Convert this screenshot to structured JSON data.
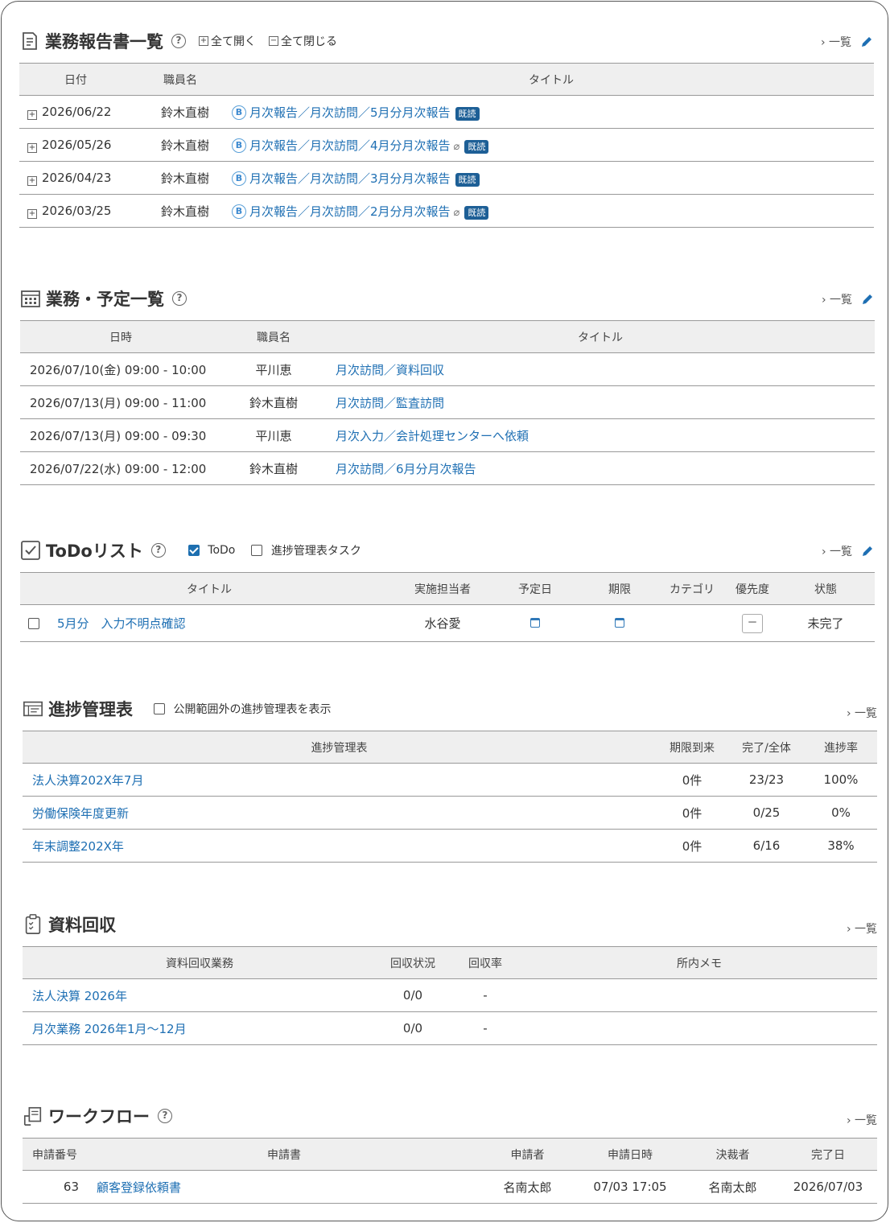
{
  "reports": {
    "title": "業務報告書一覧",
    "expand_all": "全て開く",
    "collapse_all": "全て閉じる",
    "list_link": "一覧",
    "headers": {
      "date": "日付",
      "staff": "職員名",
      "title": "タイトル"
    },
    "rows": [
      {
        "date": "2026/06/22",
        "staff": "鈴木直樹",
        "title": "月次報告／月次訪問／5月分月次報告",
        "badge": "既読",
        "attachment": false
      },
      {
        "date": "2026/05/26",
        "staff": "鈴木直樹",
        "title": "月次報告／月次訪問／4月分月次報告",
        "badge": "既読",
        "attachment": true
      },
      {
        "date": "2026/04/23",
        "staff": "鈴木直樹",
        "title": "月次報告／月次訪問／3月分月次報告",
        "badge": "既読",
        "attachment": false
      },
      {
        "date": "2026/03/25",
        "staff": "鈴木直樹",
        "title": "月次報告／月次訪問／2月分月次報告",
        "badge": "既読",
        "attachment": true
      }
    ]
  },
  "schedule": {
    "title": "業務・予定一覧",
    "list_link": "一覧",
    "headers": {
      "datetime": "日時",
      "staff": "職員名",
      "title": "タイトル"
    },
    "rows": [
      {
        "datetime": "2026/07/10(金) 09:00 - 10:00",
        "staff": "平川恵",
        "title": "月次訪問／資料回収"
      },
      {
        "datetime": "2026/07/13(月) 09:00 - 11:00",
        "staff": "鈴木直樹",
        "title": "月次訪問／監査訪問"
      },
      {
        "datetime": "2026/07/13(月) 09:00 - 09:30",
        "staff": "平川恵",
        "title": "月次入力／会計処理センターへ依頼"
      },
      {
        "datetime": "2026/07/22(水) 09:00 - 12:00",
        "staff": "鈴木直樹",
        "title": "月次訪問／6月分月次報告"
      }
    ]
  },
  "todo": {
    "title": "ToDoリスト",
    "filter_todo": "ToDo",
    "filter_progress": "進捗管理表タスク",
    "list_link": "一覧",
    "headers": {
      "title": "タイトル",
      "assignee": "実施担当者",
      "planned": "予定日",
      "deadline": "期限",
      "category": "カテゴリ",
      "priority": "優先度",
      "status": "状態"
    },
    "rows": [
      {
        "title": "5月分　入力不明点確認",
        "assignee": "水谷愛",
        "priority": "－",
        "status": "未完了"
      }
    ]
  },
  "progress": {
    "title": "進捗管理表",
    "show_private": "公開範囲外の進捗管理表を表示",
    "list_link": "一覧",
    "headers": {
      "name": "進捗管理表",
      "overdue": "期限到来",
      "done": "完了/全体",
      "rate": "進捗率"
    },
    "rows": [
      {
        "name": "法人決算202X年7月",
        "overdue": "0件",
        "done": "23/23",
        "rate": "100%"
      },
      {
        "name": "労働保険年度更新",
        "overdue": "0件",
        "done": "0/25",
        "rate": "0%"
      },
      {
        "name": "年末調整202X年",
        "overdue": "0件",
        "done": "6/16",
        "rate": "38%"
      }
    ]
  },
  "collection": {
    "title": "資料回収",
    "list_link": "一覧",
    "headers": {
      "task": "資料回収業務",
      "status": "回収状況",
      "rate": "回収率",
      "memo": "所内メモ"
    },
    "rows": [
      {
        "task": "法人決算 2026年",
        "status": "0/0",
        "rate": "-"
      },
      {
        "task": "月次業務 2026年1月～12月",
        "status": "0/0",
        "rate": "-"
      }
    ]
  },
  "workflow": {
    "title": "ワークフロー",
    "list_link": "一覧",
    "headers": {
      "number": "申請番号",
      "form": "申請書",
      "applicant": "申請者",
      "applied_at": "申請日時",
      "approver": "決裁者",
      "completed": "完了日"
    },
    "rows": [
      {
        "number": "63",
        "form": "顧客登録依頼書",
        "applicant": "名南太郎",
        "applied_at": "07/03 17:05",
        "approver": "名南太郎",
        "completed": "2026/07/03"
      }
    ]
  },
  "colors": {
    "link": "#1e6fb3",
    "badge": "#1d5f96",
    "header_bg": "#efefef"
  },
  "icons": {
    "report": "document-icon",
    "schedule": "calendar-icon",
    "todo": "checkbox-icon",
    "progress": "progress-table-icon",
    "collection": "clipboard-icon",
    "workflow": "workflow-icon",
    "edit": "pencil-icon",
    "help": "help-icon"
  }
}
